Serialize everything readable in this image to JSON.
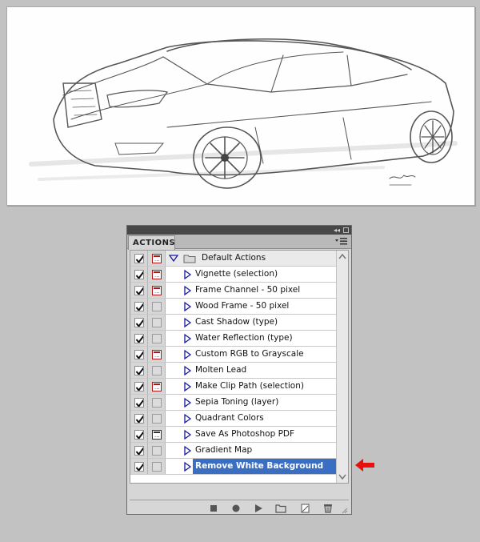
{
  "panel": {
    "tab_label": "ACTIONS",
    "collapse_icon": "double-chevron-icon",
    "close_icon": "close-box-icon",
    "menu_icon": "panel-menu-icon"
  },
  "action_set": {
    "label": "Default Actions",
    "expanded": true
  },
  "actions": [
    {
      "label": "Vignette (selection)",
      "dialog": "red"
    },
    {
      "label": "Frame Channel - 50 pixel",
      "dialog": "red"
    },
    {
      "label": "Wood Frame - 50 pixel",
      "dialog": "none"
    },
    {
      "label": "Cast Shadow (type)",
      "dialog": "none"
    },
    {
      "label": "Water Reflection (type)",
      "dialog": "none"
    },
    {
      "label": "Custom RGB to Grayscale",
      "dialog": "red"
    },
    {
      "label": "Molten Lead",
      "dialog": "none"
    },
    {
      "label": "Make Clip Path (selection)",
      "dialog": "red"
    },
    {
      "label": "Sepia Toning (layer)",
      "dialog": "none"
    },
    {
      "label": "Quadrant Colors",
      "dialog": "none"
    },
    {
      "label": "Save As Photoshop PDF",
      "dialog": "dark"
    },
    {
      "label": "Gradient Map",
      "dialog": "none"
    },
    {
      "label": "Remove White Background",
      "dialog": "none",
      "selected": true
    }
  ],
  "footer_buttons": [
    "stop-icon",
    "record-icon",
    "play-icon",
    "new-set-icon",
    "new-action-icon",
    "trash-icon"
  ],
  "colors": {
    "selection": "#3a6ec3",
    "dialog_red": "#b01818",
    "pointer_arrow": "#e8100c"
  }
}
